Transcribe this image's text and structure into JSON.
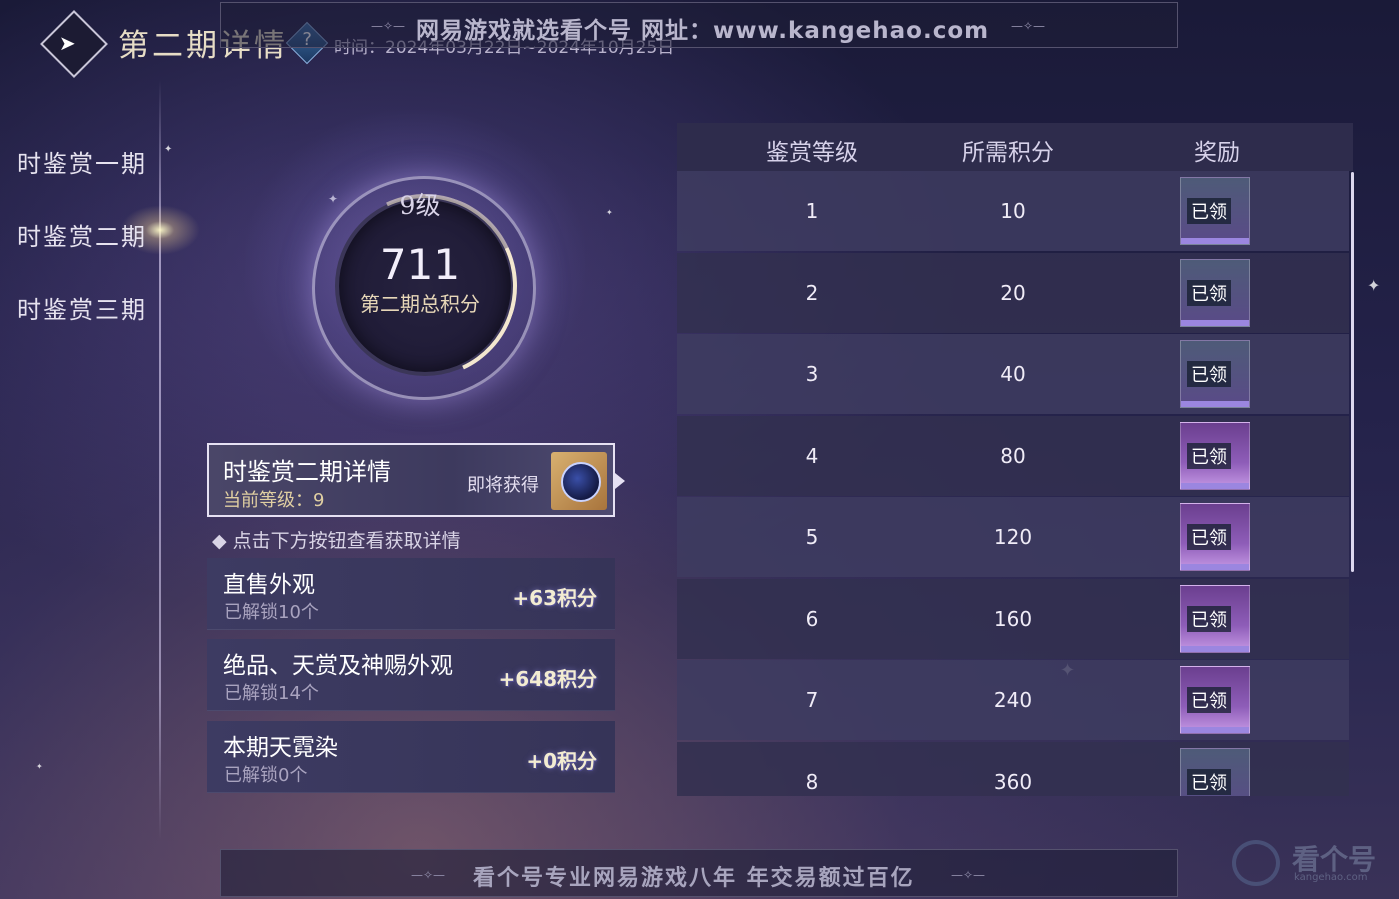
{
  "header": {
    "back_icon": "arrow-left-icon",
    "title": "第二期详情",
    "help_icon": "question-icon",
    "help_glyph": "?",
    "time_label": "时间：2024年03月22日~2024年10月25日"
  },
  "watermark_top": "网易游戏就选看个号  网址：www.kangehao.com",
  "watermark_bottom": "看个号专业网易游戏八年  年交易额过百亿",
  "logo": {
    "name": "看个号",
    "sub": "kangehao.com"
  },
  "nav": {
    "items": [
      {
        "label": "时鉴赏一期",
        "active": false
      },
      {
        "label": "时鉴赏二期",
        "active": true
      },
      {
        "label": "时鉴赏三期",
        "active": false
      }
    ]
  },
  "score": {
    "level": "9级",
    "total": "711",
    "label": "第二期总积分",
    "progress_fraction": 0.55
  },
  "detail": {
    "title": "时鉴赏二期详情",
    "current_level": "当前等级：9",
    "upcoming_label": "即将获得",
    "upcoming_icon": "orb-reward-icon"
  },
  "hint": "◆ 点击下方按钮查看获取详情",
  "sources": [
    {
      "name": "直售外观",
      "unlocked": "已解锁10个",
      "points": "+63积分"
    },
    {
      "name": "绝品、天赏及神赐外观",
      "unlocked": "已解锁14个",
      "points": "+648积分"
    },
    {
      "name": "本期天霓染",
      "unlocked": "已解锁0个",
      "points": "+0积分"
    }
  ],
  "table": {
    "headers": [
      "鉴赏等级",
      "所需积分",
      "奖励"
    ],
    "rows": [
      {
        "level": "1",
        "points": "10",
        "status": "已领",
        "style": "blue"
      },
      {
        "level": "2",
        "points": "20",
        "status": "已领",
        "style": "blue"
      },
      {
        "level": "3",
        "points": "40",
        "status": "已领",
        "style": "blue"
      },
      {
        "level": "4",
        "points": "80",
        "status": "已领",
        "style": "purple"
      },
      {
        "level": "5",
        "points": "120",
        "status": "已领",
        "style": "purple"
      },
      {
        "level": "6",
        "points": "160",
        "status": "已领",
        "style": "purple"
      },
      {
        "level": "7",
        "points": "240",
        "status": "已领",
        "style": "purple"
      },
      {
        "level": "8",
        "points": "360",
        "status": "已领",
        "style": "blue"
      }
    ]
  }
}
